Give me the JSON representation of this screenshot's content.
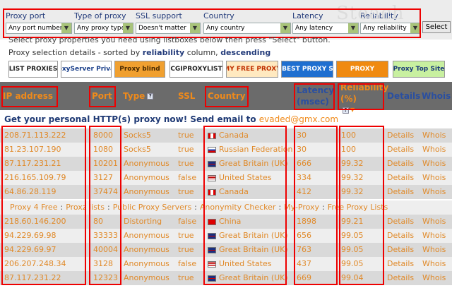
{
  "watermark": "Steach",
  "filters": {
    "proxy_port": {
      "label": "Proxy port",
      "value": "Any port number"
    },
    "type_of_proxy": {
      "label": "Type of proxy",
      "value": "Any proxy type"
    },
    "ssl_support": {
      "label": "SSL support",
      "value": "Doesn't matter"
    },
    "country": {
      "label": "Country",
      "value": "Any country"
    },
    "latency": {
      "label": "Latency",
      "value": "Any latency"
    },
    "reliability": {
      "label": "Reliability",
      "value": "Any reliability"
    },
    "select_button": "Select"
  },
  "note": "Select proxy properties you need using listboxes below then press \"Select\" button.",
  "sort": {
    "prefix": "Proxy selection details - sorted by",
    "column": "reliability",
    "middle": "column,",
    "direction": "descending"
  },
  "logos": [
    {
      "text": "LIST PROXIES",
      "bg": "#ffffff",
      "fg": "#222222"
    },
    {
      "text": "ProxyServer Privacy",
      "bg": "#ffffff",
      "fg": "#1a3f8a"
    },
    {
      "text": "Proxy blind",
      "bg": "#f0a030",
      "fg": "#4a2a00"
    },
    {
      "text": "CGIPROXYLIST",
      "bg": "#ffffff",
      "fg": "#222222"
    },
    {
      "text": "MY FREE PROXY",
      "bg": "#ffe9c0",
      "fg": "#c03000"
    },
    {
      "text": "BPS BEST PROXY SITES",
      "bg": "#1f6fd0",
      "fg": "#ffffff"
    },
    {
      "text": "PROXY",
      "bg": "#f08a10",
      "fg": "#ffffff"
    },
    {
      "text": "Proxy Top Site",
      "bg": "#c8f0a0",
      "fg": "#1a3a7a"
    }
  ],
  "headers": {
    "ip": "IP address",
    "port": "Port",
    "type": "Type",
    "ssl": "SSL",
    "country": "Country",
    "latency": "Latency (msec)",
    "reliability": "Reliability (%)",
    "details": "Details",
    "whois": "Whois"
  },
  "banner": {
    "text": "Get your personal HTTP(s) proxy now! Send email to",
    "email": "evaded@gmx.com"
  },
  "rows": [
    {
      "ip": "208.71.113.222",
      "port": "8000",
      "type": "Socks5",
      "ssl": "true",
      "flag": "ca",
      "country": "Canada",
      "latency": "30",
      "reliability": "100",
      "details": "Details",
      "whois": "Whois"
    },
    {
      "ip": "81.23.107.190",
      "port": "1080",
      "type": "Socks5",
      "ssl": "true",
      "flag": "ru",
      "country": "Russian Federation",
      "latency": "30",
      "reliability": "100",
      "details": "Details",
      "whois": "Whois"
    },
    {
      "ip": "87.117.231.21",
      "port": "10201",
      "type": "Anonymous",
      "ssl": "true",
      "flag": "gb",
      "country": "Great Britain (UK)",
      "latency": "666",
      "reliability": "99.32",
      "details": "Details",
      "whois": "Whois"
    },
    {
      "ip": "216.165.109.79",
      "port": "3127",
      "type": "Anonymous",
      "ssl": "false",
      "flag": "us",
      "country": "United States",
      "latency": "334",
      "reliability": "99.32",
      "details": "Details",
      "whois": "Whois"
    },
    {
      "ip": "64.86.28.119",
      "port": "37474",
      "type": "Anonymous",
      "ssl": "true",
      "flag": "ca",
      "country": "Canada",
      "latency": "412",
      "reliability": "99.32",
      "details": "Details",
      "whois": "Whois"
    }
  ],
  "links": [
    "Proxy 4 Free",
    "Proxz lists",
    "Public Proxy Servers",
    "Anonymity Checker",
    "My-Proxy",
    "Free Proxy Lists"
  ],
  "rows2": [
    {
      "ip": "218.60.146.200",
      "port": "80",
      "type": "Distorting",
      "ssl": "false",
      "flag": "cn",
      "country": "China",
      "latency": "1898",
      "reliability": "99.21",
      "details": "Details",
      "whois": "Whois"
    },
    {
      "ip": "94.229.69.98",
      "port": "33333",
      "type": "Anonymous",
      "ssl": "true",
      "flag": "gb",
      "country": "Great Britain (UK)",
      "latency": "656",
      "reliability": "99.05",
      "details": "Details",
      "whois": "Whois"
    },
    {
      "ip": "94.229.69.97",
      "port": "40004",
      "type": "Anonymous",
      "ssl": "true",
      "flag": "gb",
      "country": "Great Britain (UK)",
      "latency": "763",
      "reliability": "99.05",
      "details": "Details",
      "whois": "Whois"
    },
    {
      "ip": "206.207.248.34",
      "port": "3128",
      "type": "Anonymous",
      "ssl": "false",
      "flag": "us",
      "country": "United States",
      "latency": "437",
      "reliability": "99.05",
      "details": "Details",
      "whois": "Whois"
    },
    {
      "ip": "87.117.231.22",
      "port": "12323",
      "type": "Anonymous",
      "ssl": "true",
      "flag": "gb",
      "country": "Great Britain (UK)",
      "latency": "669",
      "reliability": "99.04",
      "details": "Details",
      "whois": "Whois"
    }
  ]
}
